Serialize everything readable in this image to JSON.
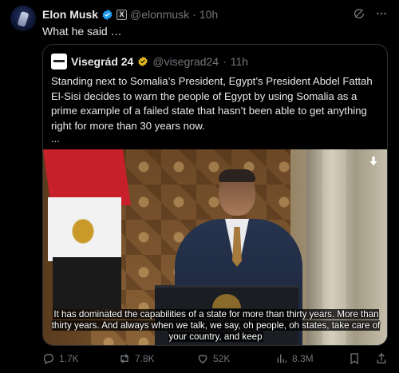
{
  "post": {
    "author_name": "Elon Musk",
    "handle": "@elonmusk",
    "separator": "·",
    "time": "10h",
    "x_badge": "X",
    "text": "What he said …"
  },
  "quote": {
    "author_name": "Visegrád 24",
    "handle": "@visegrad24",
    "separator": "·",
    "time": "11h",
    "text": "Standing next to Somalia’s President, Egypt’s President Abdel Fattah El-Sisi decides to warn the people of Egypt by using Somalia as a prime example of a failed state that hasn’t been able to get anything right for more than 30 years now.",
    "ellipsis": "...",
    "video_caption": "It has dominated the capabilities of a state for more than thirty years. More than thirty years. And always when we talk, we say, oh people, oh states, take care of your country, and keep"
  },
  "actions": {
    "replies": "1.7K",
    "reposts": "7.8K",
    "likes": "52K",
    "views": "8.3M"
  },
  "colors": {
    "background": "#000000",
    "text": "#e7e9ea",
    "muted": "#71767b",
    "verified_blue": "#1d9bf0",
    "verified_gold": "#e2b719",
    "border": "#2f3336"
  },
  "icons": {
    "verified": "verified-badge-icon",
    "gold_verified": "gold-verified-badge-icon",
    "grok": "grok-icon",
    "more": "more-icon",
    "reply": "reply-icon",
    "repost": "repost-icon",
    "like": "heart-icon",
    "views": "views-icon",
    "bookmark": "bookmark-icon",
    "share": "share-icon",
    "download": "download-arrow-icon"
  }
}
